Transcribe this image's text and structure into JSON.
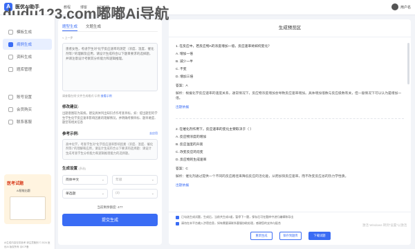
{
  "topbar": {
    "logo_text": "医优AI助手",
    "nav": [
      "教程",
      "博客",
      "API文档"
    ],
    "user_name": "用户名",
    "watermark": "dudu123.com嘟嘟Ai导航"
  },
  "sidebar": {
    "items": [
      {
        "label": "模板生成"
      },
      {
        "label": "病例生成"
      },
      {
        "label": "资料生成"
      },
      {
        "label": "题库管理"
      },
      {
        "label": "账号设置"
      },
      {
        "label": "会员购买"
      },
      {
        "label": "联系客服"
      }
    ],
    "promo_title": "医考试题",
    "promo_sub": "AI智能出题",
    "footer": "AI生成内容仅供参考 请注意甄别 © 2024 医优AI 版权所有 京ICP备"
  },
  "form": {
    "tabs": [
      "题型生成",
      "文题生成"
    ],
    "crumb": "< 上一步",
    "input_text": "患者女性，考虑学生对“化学反应速率的测定（浓度、温度、催化剂等）”的理解及应用，请设计生成符合以下题目要求的选择题，并请注意设计考察其分析能力和逻辑推理。",
    "hint": "请查看在线“文件生成格式”示例",
    "hint_link": "查看示例",
    "mod_title": "修改建议:",
    "mod_text": "出题意图较为笼统，建议具体列出知识点作考查目标，如：提出题型的学生学生化学反应速率影响因素的理解情况，并明确考察目标、题目难度、题型等相关信息",
    "ref_title": "参考示例:",
    "ref_link": "去应用",
    "ref_text": "高中化学，考查学生对“化学反应速率影响因素（浓度、温度、催化剂等）”的理解和应用，请设计生成符合以下要求的选择题：请设计生成考查学生分析能力和逻辑推理能力的选择题。",
    "gen_title": "生成设置",
    "gen_hint": "(多选)",
    "lang_value": "简体中文",
    "grade_placeholder": "年级",
    "type_value": "单选题",
    "count_placeholder": "(3)",
    "token_text": "当前剩余额度: 477",
    "submit_label": "提交生成"
  },
  "preview": {
    "title": "生成预览区",
    "questions": [
      {
        "stem": "1. 在反应中，若反应物A的浓度增加一倍，反应速率将如何变化？",
        "options": [
          "A. 增加一倍",
          "B. 减少一半",
          "C. 不变",
          "D. 增加三倍"
        ],
        "answer": "答案：A",
        "explanation": "解析：根据化学反应速率的速度关系，通常情况下，反应物浓度增加会导致反应速率增加。具体增加倍数与反应级数有关，但一般情况下可以认为是增加一倍。",
        "source": "出题依据"
      },
      {
        "stem": "2. 在催化剂作用下，反应速率的变化主要取决于（   ）",
        "options": [
          "A. 反应物浓度的增加",
          "B. 反应温度的升高",
          "C. 改变反应的焓变",
          "D. 反应物的生成速率"
        ],
        "answer": "答案：C",
        "explanation": "解析：催化剂通过提供一个不同的反应路径来降低反应的活化能，从而加快反应速率，而不改变反应总的热力学性质。",
        "source": "出题依据"
      }
    ],
    "check1": "已勾选生成试题，生成后，当前共生成3道，暂停下一题，保存后可在题库中进行编辑和导出",
    "check2": "请勿在本平台输入涉密信息，如有需要请联系客服协助处理，感谢您的支持与配合",
    "btn_regen": "重新生成",
    "btn_save": "保存到题库",
    "btn_download": "下载试题"
  },
  "os_watermark": "激活 Windows 转到“设置”以激活"
}
